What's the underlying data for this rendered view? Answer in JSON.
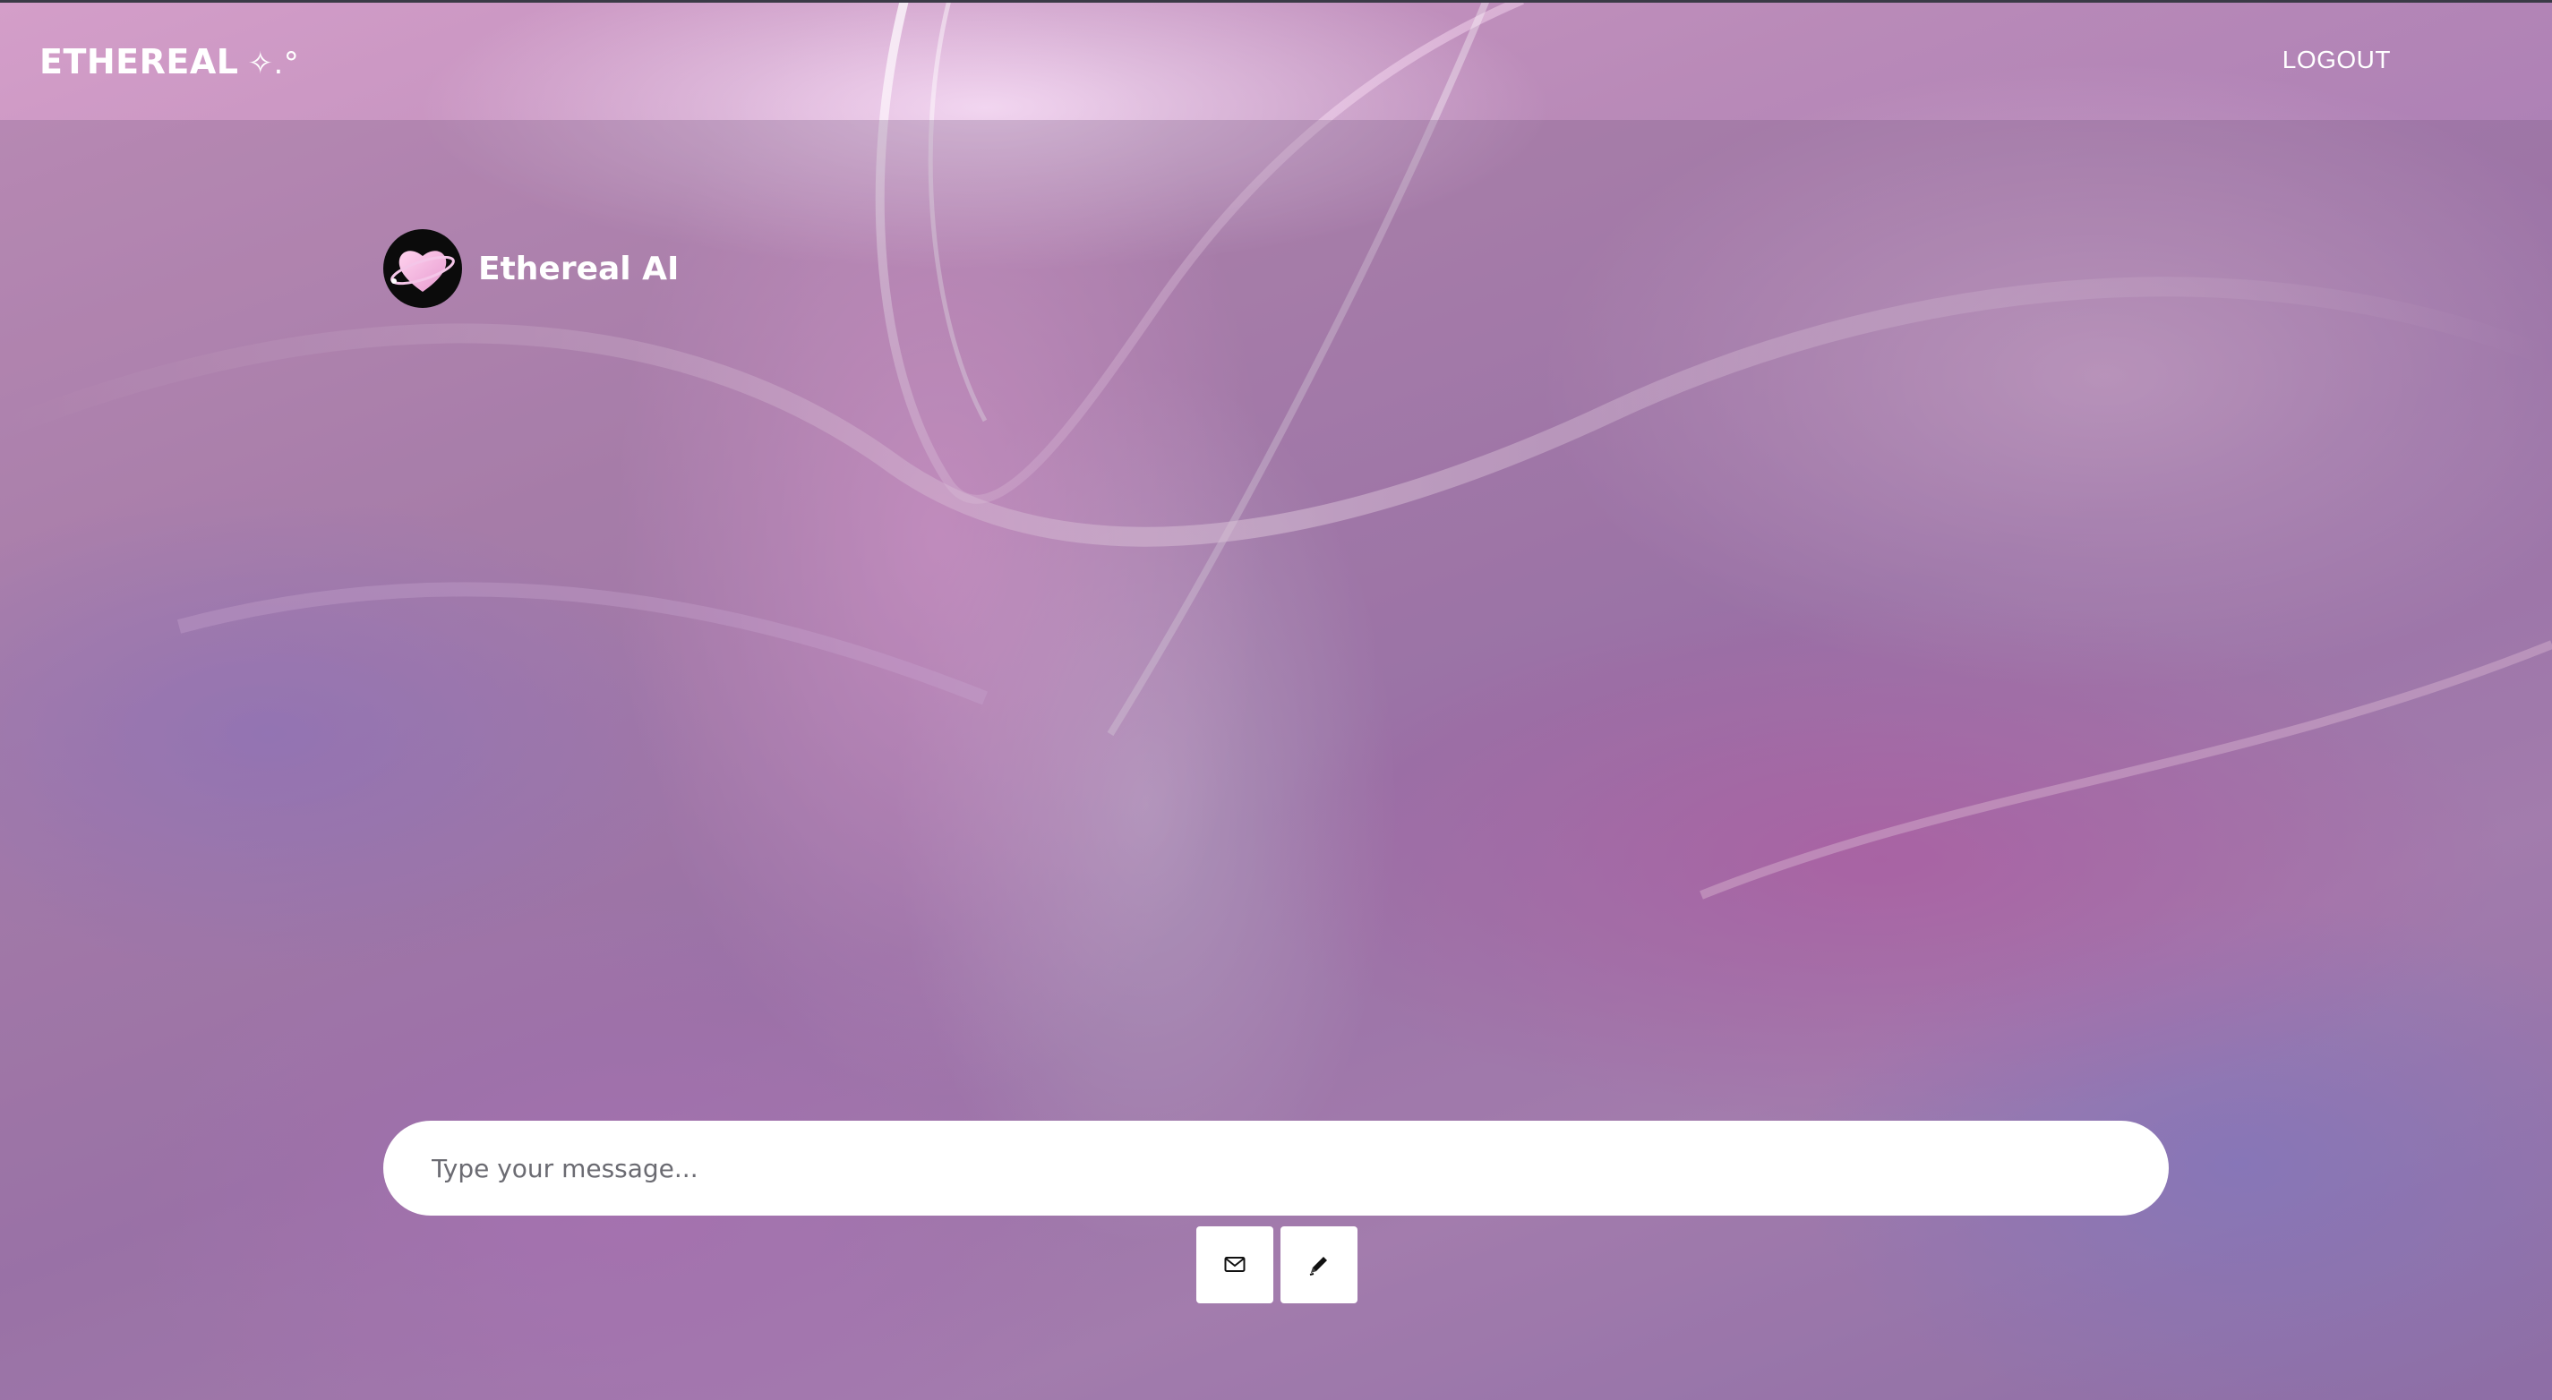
{
  "app": {
    "brand": "ETHEREAL",
    "brand_sparkle": "✧.°"
  },
  "nav": {
    "logout_label": "LOGOUT"
  },
  "chat": {
    "bot_name": "Ethereal AI",
    "avatar_icon": "heart-planet-icon"
  },
  "composer": {
    "placeholder": "Type your message...",
    "value": "",
    "send_icon": "envelope-icon",
    "draw_icon": "pencil-icon"
  },
  "colors": {
    "accent_pink": "#f3a6d8",
    "text": "#ffffff",
    "avatar_bg": "#0b0b0b"
  }
}
